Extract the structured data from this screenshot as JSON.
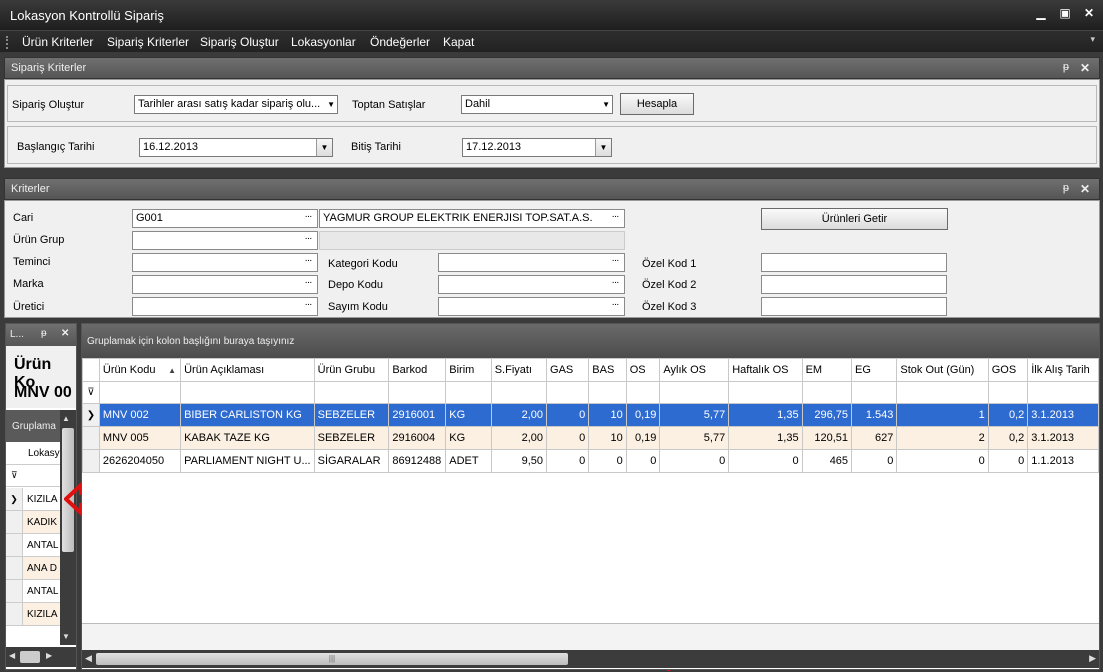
{
  "window": {
    "title": "Lokasyon Kontrollü Sipariş"
  },
  "menu": {
    "items": [
      "Ürün Kriterler",
      "Sipariş Kriterler",
      "Sipariş Oluştur",
      "Lokasyonlar",
      "Öndeğerler",
      "Kapat"
    ]
  },
  "siparis_panel": {
    "title": "Sipariş Kriterler",
    "siparis_olustur_label": "Sipariş Oluştur",
    "siparis_olustur_value": "Tarihler arası satış kadar sipariş olu...",
    "toptan_label": "Toptan Satışlar",
    "toptan_value": "Dahil",
    "hesapla_label": "Hesapla",
    "baslangic_label": "Başlangıç Tarihi",
    "baslangic_value": "16.12.2013",
    "bitis_label": "Bitiş Tarihi",
    "bitis_value": "17.12.2013"
  },
  "kriterler_panel": {
    "title": "Kriterler",
    "cari_label": "Cari",
    "cari_code": "G001",
    "cari_name": "YAGMUR GROUP ELEKTRIK ENERJISI TOP.SAT.A.S.",
    "urun_grup_label": "Ürün Grup",
    "temin_label": "Teminci",
    "marka_label": "Marka",
    "uretici_label": "Üretici",
    "kategori_label": "Kategori Kodu",
    "depo_label": "Depo Kodu",
    "sayim_label": "Sayım Kodu",
    "ozel1_label": "Özel Kod 1",
    "ozel2_label": "Özel Kod 2",
    "ozel3_label": "Özel Kod 3",
    "urunleri_getir_label": "Ürünleri Getir"
  },
  "left_panel": {
    "title": "L...",
    "big1": "Ürün Ko",
    "big2": "MNV 00",
    "group_text": "Gruplama",
    "col": "Lokasy",
    "rows": [
      "KIZILA",
      "KADIK",
      "ANTAL",
      "ANA D",
      "ANTAL",
      "KIZILA"
    ]
  },
  "grid": {
    "group_hint": "Gruplamak için kolon başlığını buraya taşıyınız",
    "columns": [
      "Ürün Kodu",
      "Ürün Açıklaması",
      "Ürün Grubu",
      "Barkod",
      "Birim",
      "S.Fiyatı",
      "GAS",
      "BAS",
      "OS",
      "Aylık OS",
      "Haftalık OS",
      "EM",
      "EG",
      "Stok Out (Gün)",
      "GOS",
      "İlk Alış Tarih"
    ],
    "rows": [
      [
        "MNV 002",
        "BIBER CARLISTON KG",
        "SEBZELER",
        "2916001",
        "KG",
        "2,00",
        "0",
        "10",
        "0,19",
        "5,77",
        "1,35",
        "296,75",
        "1.543",
        "1",
        "0,2",
        "3.1.2013"
      ],
      [
        "MNV 005",
        "KABAK TAZE KG",
        "SEBZELER",
        "2916004",
        "KG",
        "2,00",
        "0",
        "10",
        "0,19",
        "5,77",
        "1,35",
        "120,51",
        "627",
        "2",
        "0,2",
        "3.1.2013"
      ],
      [
        "2626204050",
        "PARLIAMENT NIGHT U...",
        "SİGARALAR",
        "86912488",
        "ADET",
        "9,50",
        "0",
        "0",
        "0",
        "0",
        "0",
        "465",
        "0",
        "0",
        "0",
        "1.1.2013"
      ]
    ]
  },
  "colors": {
    "selection": "#2e6bd1",
    "alt_row": "#fbf0e2",
    "arrow": "#e01010"
  }
}
